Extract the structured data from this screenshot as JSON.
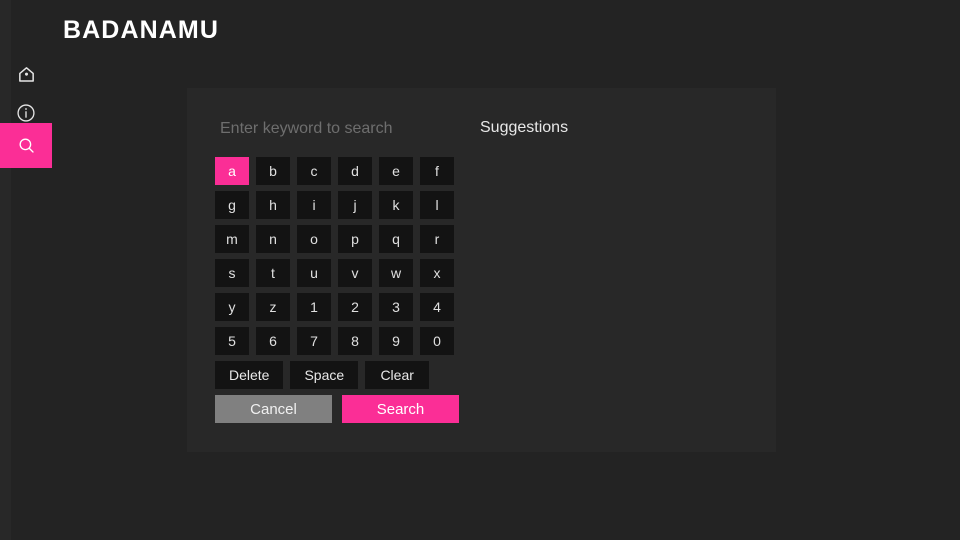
{
  "app": {
    "logo_text": "BADANAMU",
    "background_color": "#232323",
    "accent_color": "#fb2e96",
    "panel_color": "#282828"
  },
  "sidebar": {
    "items": [
      {
        "icon": "home-icon",
        "label": "Home",
        "selected": false
      },
      {
        "icon": "info-icon",
        "label": "Info",
        "selected": false
      },
      {
        "icon": "search-icon",
        "label": "Search",
        "selected": true
      }
    ]
  },
  "search": {
    "input_value": "",
    "placeholder": "Enter keyword to search",
    "suggestions_title": "Suggestions",
    "suggestions": []
  },
  "keyboard": {
    "selected_key": "a",
    "rows": [
      [
        "a",
        "b",
        "c",
        "d",
        "e",
        "f"
      ],
      [
        "g",
        "h",
        "i",
        "j",
        "k",
        "l"
      ],
      [
        "m",
        "n",
        "o",
        "p",
        "q",
        "r"
      ],
      [
        "s",
        "t",
        "u",
        "v",
        "w",
        "x"
      ],
      [
        "y",
        "z",
        "1",
        "2",
        "3",
        "4"
      ],
      [
        "5",
        "6",
        "7",
        "8",
        "9",
        "0"
      ]
    ],
    "utility_keys": [
      "Delete",
      "Space",
      "Clear"
    ],
    "cancel_label": "Cancel",
    "search_label": "Search"
  }
}
